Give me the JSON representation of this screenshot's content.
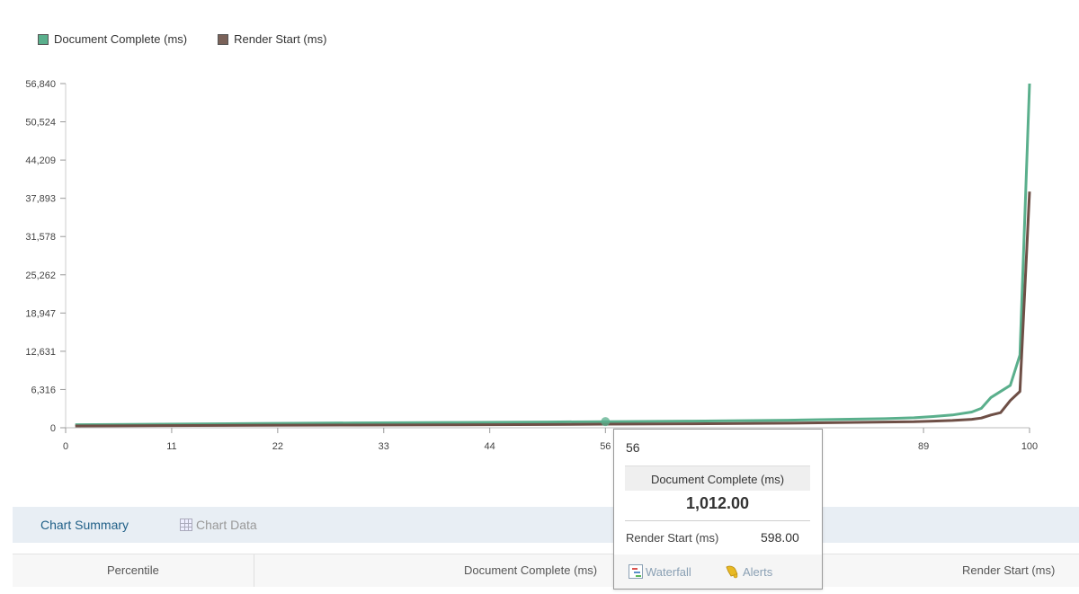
{
  "legend": {
    "items": [
      {
        "label": "Document Complete (ms)",
        "color": "#5aaf8c"
      },
      {
        "label": "Render Start (ms)",
        "color": "#7a6259"
      }
    ]
  },
  "chart_data": {
    "type": "line",
    "xlabel": "",
    "ylabel": "",
    "xlim": [
      0,
      100
    ],
    "ylim": [
      0,
      56840
    ],
    "x_ticks": [
      0,
      11,
      22,
      33,
      44,
      56,
      89,
      100
    ],
    "y_ticks": [
      0,
      6316,
      12631,
      18947,
      25262,
      31578,
      37893,
      44209,
      50524,
      56840
    ],
    "y_tick_labels": [
      "0",
      "6,316",
      "12,631",
      "18,947",
      "25,262",
      "31,578",
      "37,893",
      "44,209",
      "50,524",
      "56,840"
    ],
    "grid": false,
    "legend_position": "top-left",
    "series": [
      {
        "name": "Document Complete (ms)",
        "color": "#5aaf8c",
        "x": [
          1,
          10,
          20,
          30,
          40,
          50,
          56,
          65,
          75,
          85,
          88,
          90,
          92,
          94,
          95,
          96,
          98,
          99,
          100
        ],
        "values": [
          500,
          600,
          700,
          800,
          870,
          950,
          1012,
          1100,
          1250,
          1500,
          1650,
          1850,
          2100,
          2600,
          3200,
          5000,
          7000,
          12000,
          56840
        ]
      },
      {
        "name": "Render Start (ms)",
        "color": "#6e4f46",
        "x": [
          1,
          10,
          20,
          30,
          40,
          50,
          56,
          65,
          75,
          85,
          88,
          90,
          92,
          94,
          95,
          96,
          97,
          98,
          99,
          100
        ],
        "values": [
          300,
          350,
          400,
          440,
          480,
          540,
          598,
          650,
          750,
          950,
          1000,
          1100,
          1200,
          1400,
          1600,
          2100,
          2500,
          4500,
          6000,
          39000
        ]
      }
    ],
    "highlight_point": {
      "x": 56,
      "y": 1012
    }
  },
  "tooltip": {
    "x_value": "56",
    "series_header": "Document Complete (ms)",
    "main_value": "1,012.00",
    "row_label": "Render Start (ms)",
    "row_value": "598.00",
    "waterfall_label": "Waterfall",
    "alerts_label": "Alerts"
  },
  "summary_tabs": {
    "summary_label": "Chart Summary",
    "data_label": "Chart Data"
  },
  "table": {
    "columns": [
      "Percentile",
      "Document Complete (ms)",
      "Render Start (ms)"
    ]
  }
}
